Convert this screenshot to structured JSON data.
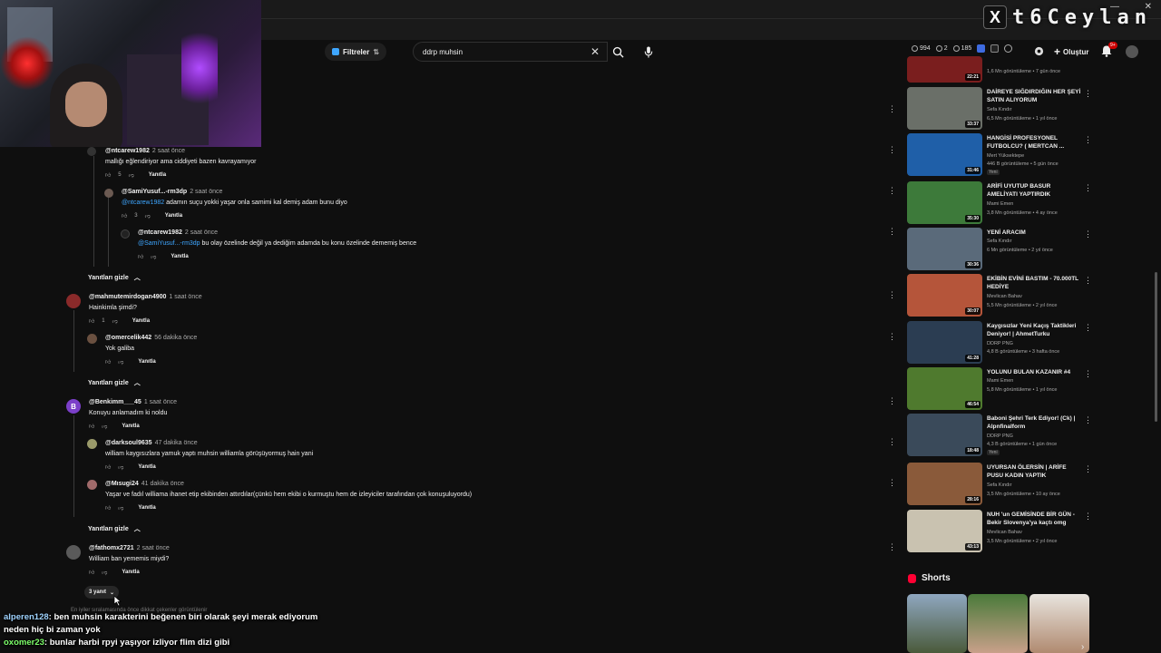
{
  "stream": {
    "name": "t6Ceylan",
    "logo": "X"
  },
  "search": {
    "filters_label": "Filtreler",
    "query": "ddrp muhsin"
  },
  "header": {
    "stats": [
      "994",
      "2",
      "185"
    ],
    "create_label": "Oluştur",
    "notif_count": "9+"
  },
  "comments": [
    {
      "author": "@ntcarew1982",
      "time": "2 saat önce",
      "text": "mallığı eğlendiriyor ama ciddiyeti bazen kavrayamıyor",
      "likes": "5",
      "reply": "Yanıtla"
    },
    {
      "author": "@SamiYusuf...-rm3dp",
      "time": "2 saat önce",
      "mention": "@ntcarew1982",
      "text": "adamın suçu yokki yaşar onla samimi kal demiş adam bunu diyo",
      "likes": "3",
      "reply": "Yanıtla"
    },
    {
      "author": "@ntcarew1982",
      "time": "2 saat önce",
      "mention": "@SamiYusuf...-rm3dp",
      "text": "bu olay özelinde değil ya dediğim adamda bu konu özelinde dememiş bence",
      "likes": "",
      "reply": "Yanıtla"
    },
    {
      "author": "@mahmutemirdogan4900",
      "time": "1 saat önce",
      "text": "Hainkimla şimdi?",
      "likes": "1",
      "reply": "Yanıtla"
    },
    {
      "author": "@omercelik442",
      "time": "56 dakika önce",
      "text": "Yok galiba",
      "likes": "",
      "reply": "Yanıtla"
    },
    {
      "author": "@Benkimm___45",
      "time": "1 saat önce",
      "text": "Konuyu anlamadım ki noldu",
      "likes": "",
      "reply": "Yanıtla"
    },
    {
      "author": "@darksoul9635",
      "time": "47 dakika önce",
      "text": "william kaygısızlara yamuk yaptı muhsin williamla görüşüyormuş hain yani",
      "likes": "",
      "reply": "Yanıtla"
    },
    {
      "author": "@Mısugi24",
      "time": "41 dakika önce",
      "text": "Yaşar ve fadıl  williama ihanet etip ekibinden attırdılar(çünkü hem ekibi o kurmuştu hem de izleyiciler tarafından çok konuşuluyordu)",
      "likes": "",
      "reply": "Yanıtla"
    },
    {
      "author": "@fathomx2721",
      "time": "2 saat önce",
      "text": "William ban yememis miydi?",
      "likes": "",
      "reply": "Yanıtla"
    }
  ],
  "hide_replies_label": "Yanıtları gizle",
  "more_replies_label": "3 yanıt",
  "footnote": "En iyiler sıralamasında önce dikkat çekenler görüntülenir",
  "sidebar": {
    "videos": [
      {
        "title": "",
        "channel": "",
        "meta": "1,6 Mn görüntüleme • 7 gün önce",
        "duration": "22:21",
        "color": "#7a1e1e"
      },
      {
        "title": "DAİREYE SIĞDIRDIĞIN HER ŞEYİ SATIN ALIYORUM",
        "channel": "Sefa Kındır",
        "meta": "6,5 Mn görüntüleme • 1 yıl önce",
        "duration": "33:37",
        "color": "#6a6f68"
      },
      {
        "title": "HANGİSİ PROFESYONEL FUTBOLCU? ( MERTCAN ...",
        "channel": "Mert Yüksektepe",
        "meta": "446 B görüntüleme • 5 gün önce",
        "badge": "Yeni",
        "duration": "31:46",
        "color": "#1f5fa8"
      },
      {
        "title": "ARİFİ UYUTUP BASUR AMELİYATI YAPTIRDIK",
        "channel": "Mami Emen",
        "meta": "3,8 Mn görüntüleme • 4 ay önce",
        "duration": "35:30",
        "color": "#3d7a3a"
      },
      {
        "title": "YENİ ARACIM",
        "channel": "Sefa Kındır",
        "meta": "6 Mn görüntüleme • 2 yıl önce",
        "duration": "30:36",
        "color": "#5a6a7a"
      },
      {
        "title": "EKİBİN EVİNİ BASTIM - 70.000TL HEDİYE",
        "channel": "Mevlican Bahav",
        "meta": "5,5 Mn görüntüleme • 2 yıl önce",
        "duration": "30:07",
        "color": "#b5553a"
      },
      {
        "title": "Kaygısızlar Yeni Kaçış Taktikleri Deniyor! | AhmetTurku",
        "channel": "DDRP PNG",
        "meta": "4,8 B görüntüleme • 3 hafta önce",
        "duration": "41:28",
        "color": "#2b3d52"
      },
      {
        "title": "YOLUNU BULAN KAZANIR #4",
        "channel": "Mami Emen",
        "meta": "5,8 Mn görüntüleme • 1 yıl önce",
        "duration": "46:54",
        "color": "#4f7a2e"
      },
      {
        "title": "Baboni Şehri Terk Ediyor! (Ck) | Alpnfinalform",
        "channel": "DDRP PNG",
        "meta": "4,3 B görüntüleme • 1 gün önce",
        "badge": "Yeni",
        "duration": "18:48",
        "color": "#3a4a5a"
      },
      {
        "title": "UYURSAN ÖLERSİN | ARİFE PUSU KADIN YAPTIK",
        "channel": "Sefa Kındır",
        "meta": "3,5 Mn görüntüleme • 10 ay önce",
        "duration": "28:16",
        "color": "#8a5a3a"
      },
      {
        "title": "NUH 'un GEMİSİNDE BİR GÜN - Bekir Slovenya'ya kaçtı omg",
        "channel": "Mevlican Bahav",
        "meta": "3,5 Mn görüntüleme • 2 yıl önce",
        "duration": "43:13",
        "color": "#c9c2b0"
      }
    ],
    "shorts_label": "Shorts"
  },
  "chat": [
    {
      "user": "alperen128",
      "text": ": ben muhsin karakterini beğenen biri olarak şeyi merak ediyorum"
    },
    {
      "user": "",
      "text": "neden hiç bi zaman yok"
    },
    {
      "user": "oxomer23",
      "text": ": bunlar harbi rpyi yaşıyor izliyor flim dizi gibi"
    }
  ]
}
